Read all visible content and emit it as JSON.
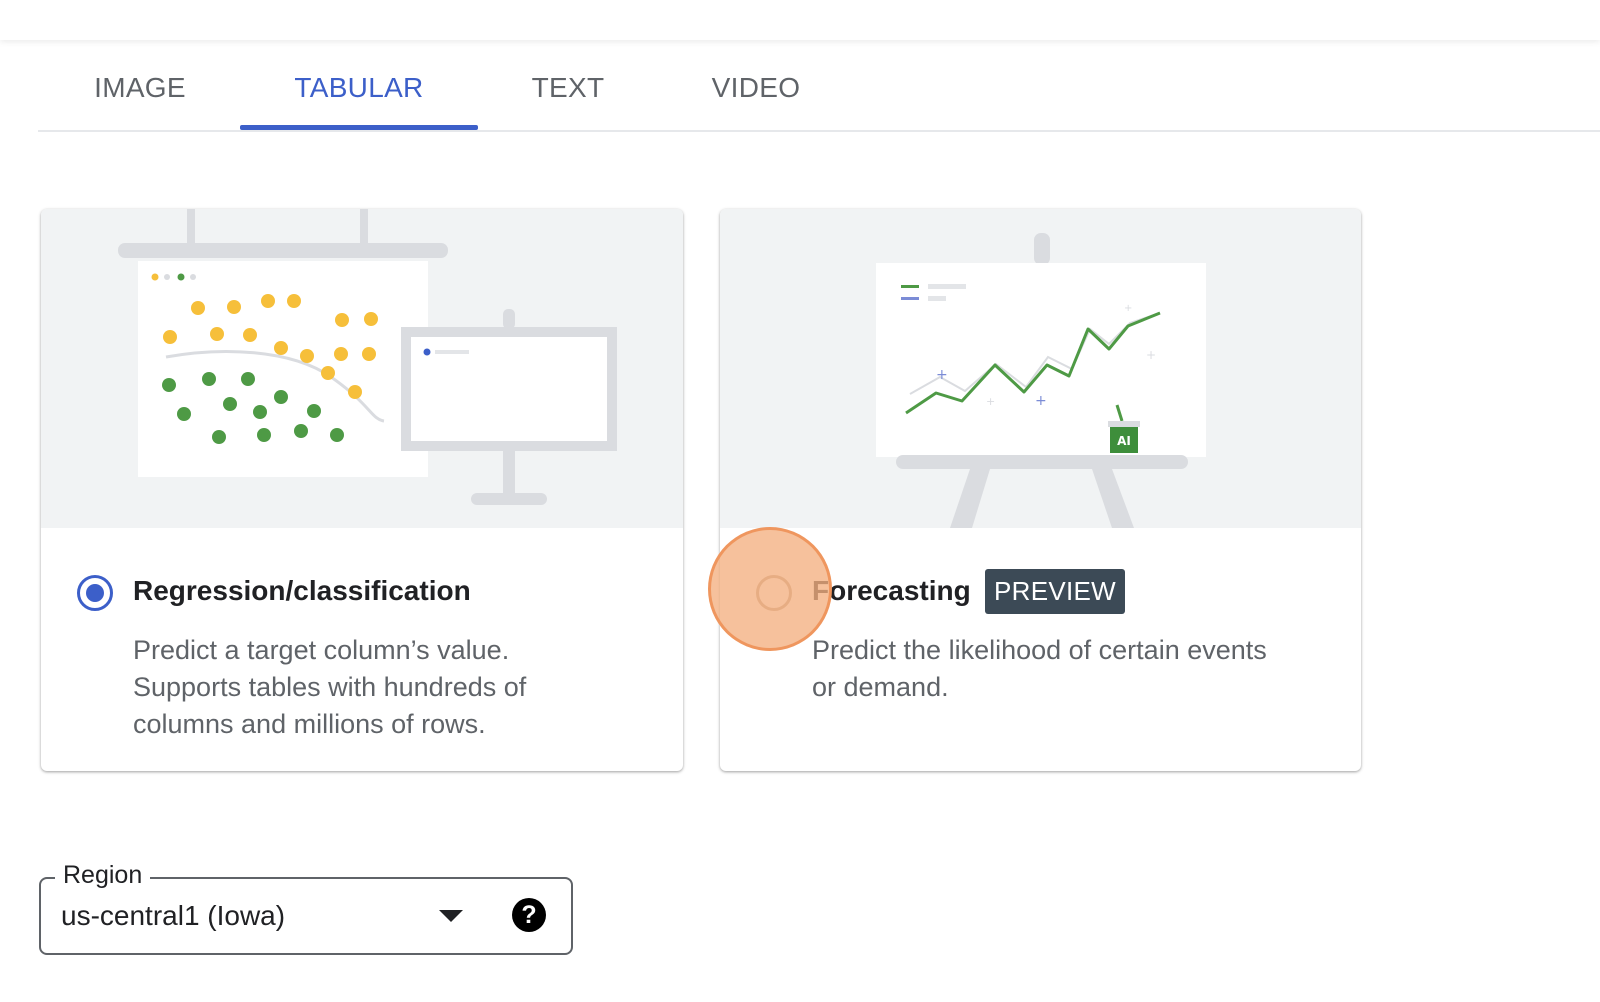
{
  "tabs": [
    {
      "label": "IMAGE",
      "active": false
    },
    {
      "label": "TABULAR",
      "active": true
    },
    {
      "label": "TEXT",
      "active": false
    },
    {
      "label": "VIDEO",
      "active": false
    }
  ],
  "colors": {
    "accent": "#3c5fc9",
    "badge_bg": "#3c4a56",
    "dot_yellow": "#f6bf3a",
    "dot_green": "#4e9a45",
    "line_green": "#4e9a45"
  },
  "cards": [
    {
      "title": "Regression/classification",
      "description_lines": [
        "Predict a target column’s value.",
        "Supports tables with hundreds of",
        "columns and millions of rows."
      ],
      "selected": true,
      "illustration": "scatter-chart-illustration"
    },
    {
      "title": "Forecasting",
      "badge": "PREVIEW",
      "description_lines": [
        "Predict the likelihood of certain events",
        "or demand."
      ],
      "selected": false,
      "illustration": "line-chart-easel-illustration",
      "illustration_badge": "AI"
    }
  ],
  "region": {
    "label": "Region",
    "value": "us-central1 (Iowa)",
    "help_icon": "?"
  }
}
